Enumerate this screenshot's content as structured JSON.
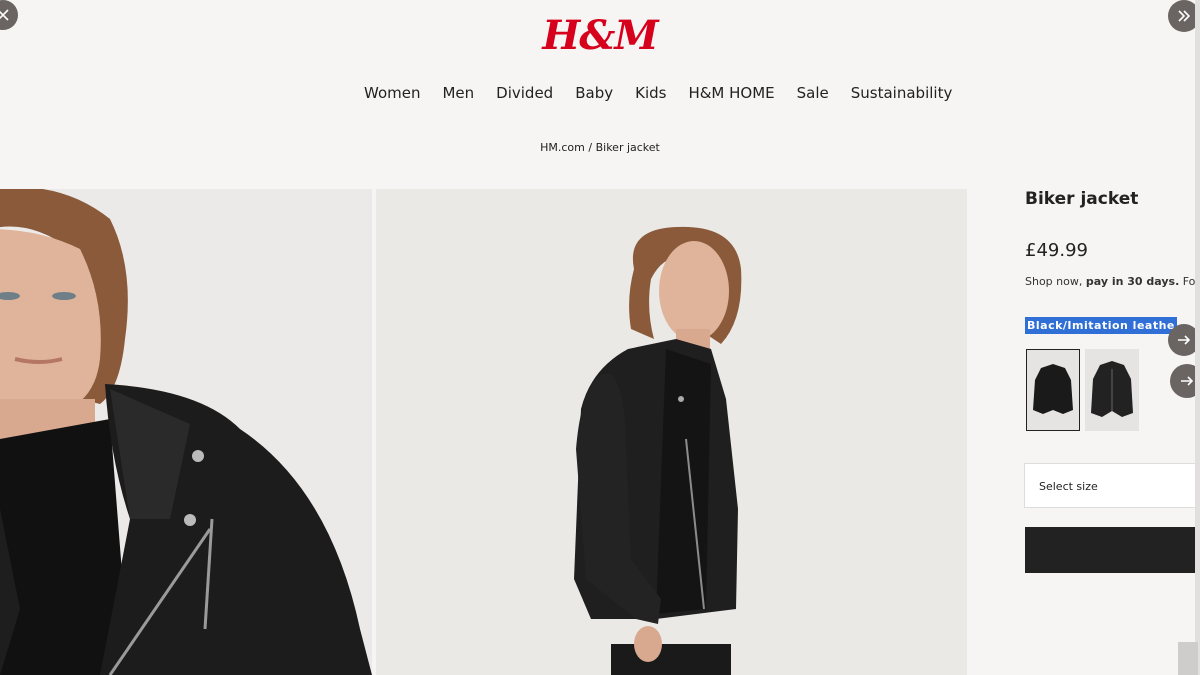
{
  "logo": "H&M",
  "nav": [
    "Women",
    "Men",
    "Divided",
    "Baby",
    "Kids",
    "H&M HOME",
    "Sale",
    "Sustainability"
  ],
  "breadcrumb": {
    "home": "HM.com",
    "sep": " / ",
    "current": "Biker jacket"
  },
  "product": {
    "title": "Biker jacket",
    "price": "£49.99",
    "pay_prefix": "Shop now, ",
    "pay_bold": "pay in 30 days.",
    "pay_suffix": " For me",
    "color": "Black/Imitation leathe"
  },
  "size": {
    "placeholder": "Select size"
  },
  "colors": {
    "accent": "#d6001c",
    "highlight": "#2f6fd6",
    "button": "#222222"
  },
  "icons": [
    "close-icon",
    "double-chevron-right-icon",
    "arrow-right-icon",
    "arrow-right-icon"
  ]
}
